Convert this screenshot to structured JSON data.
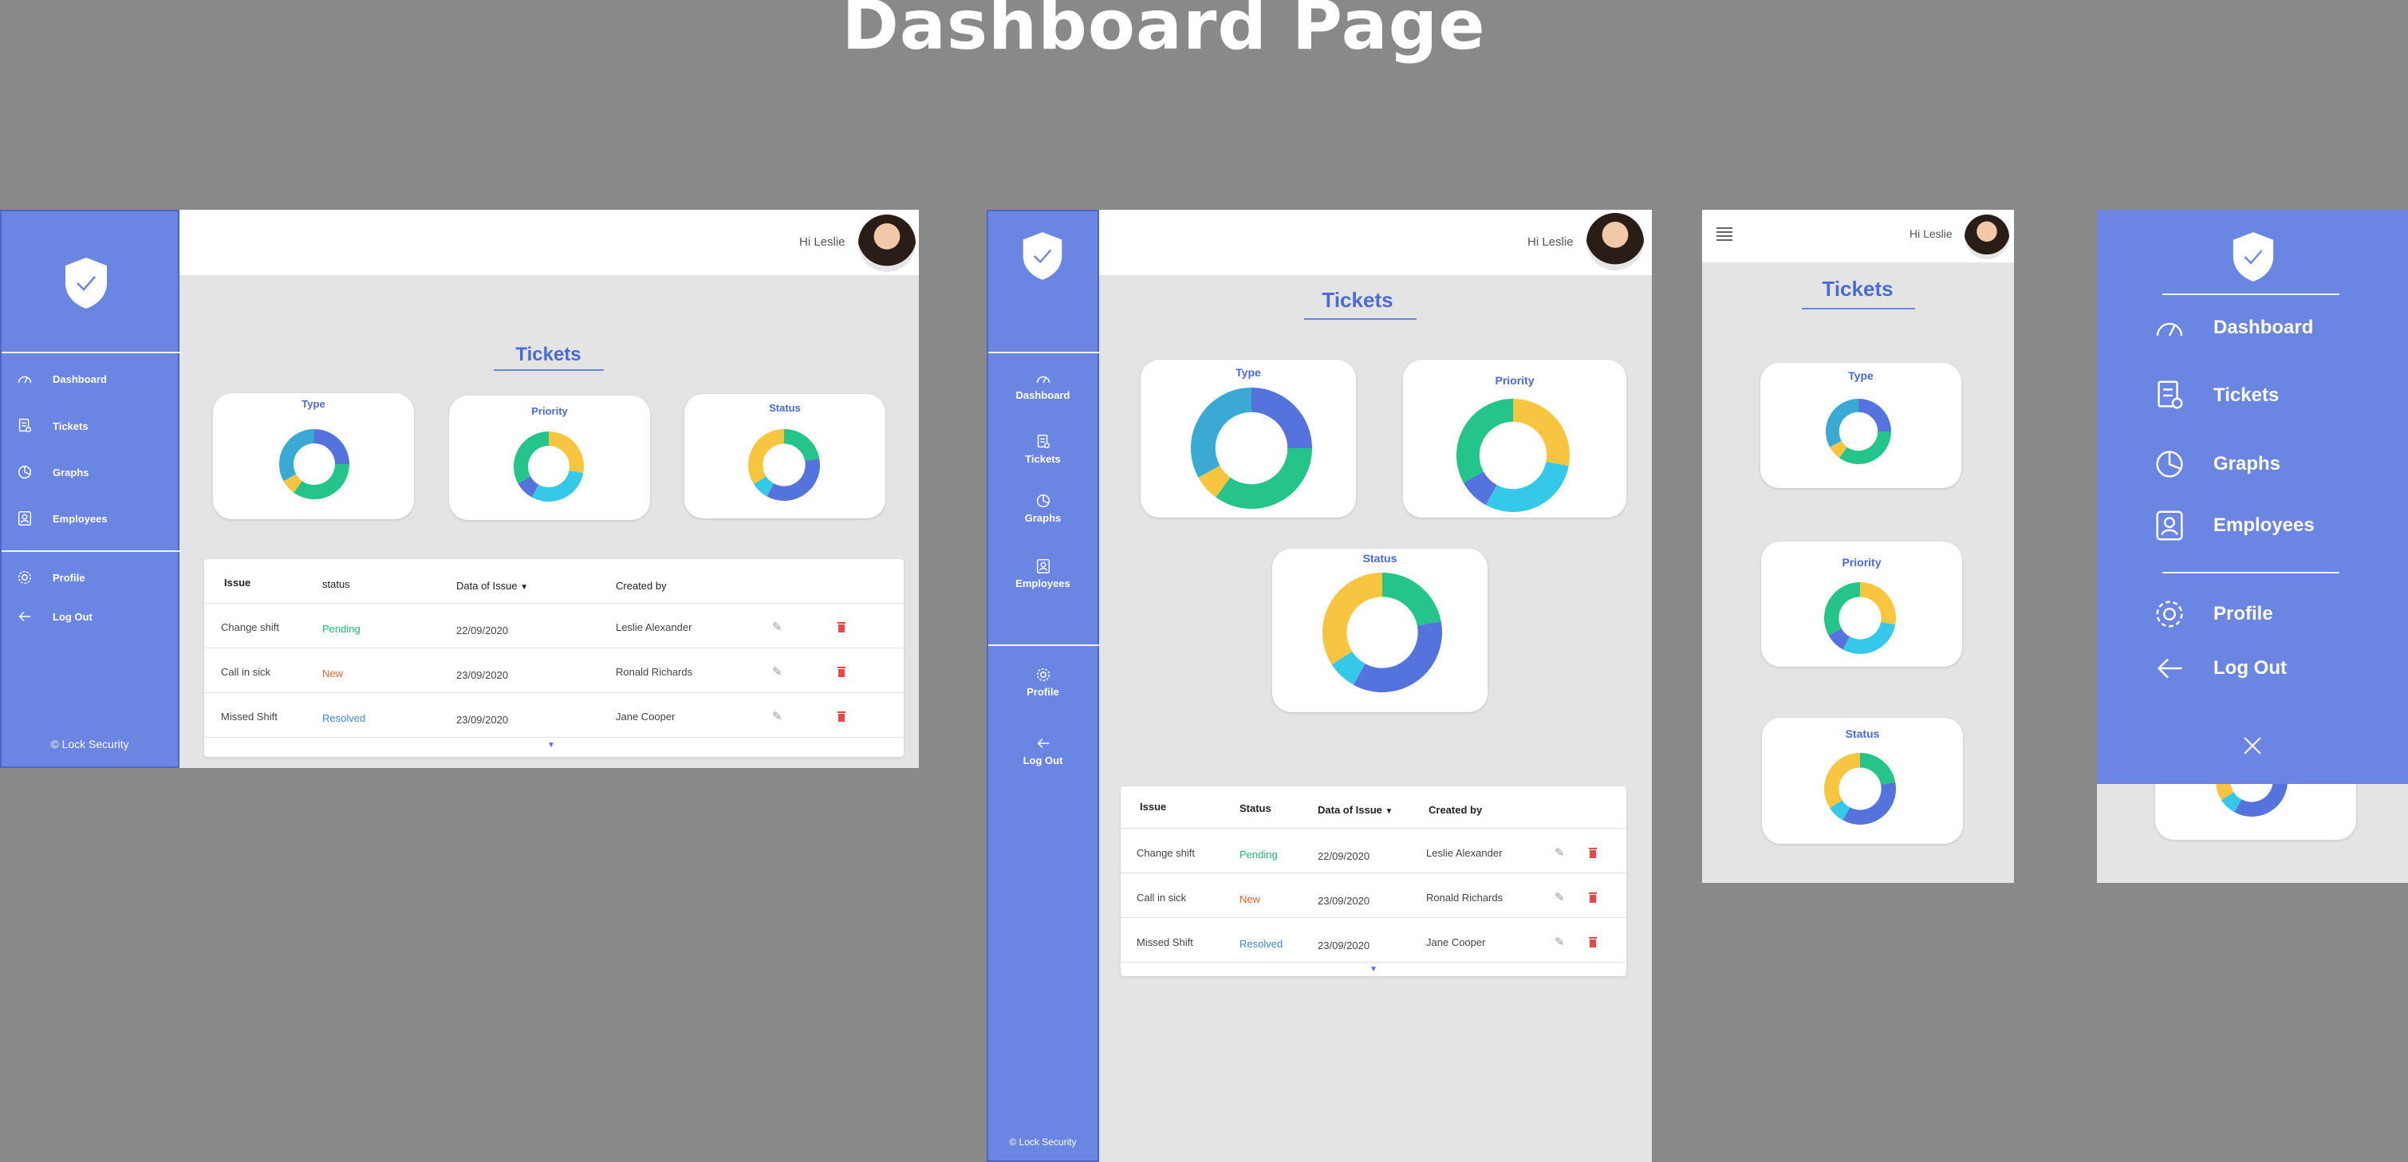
{
  "page_title": "Dashboard Page",
  "brand": "© Lock Security",
  "greeting": "Hi Leslie",
  "section_title": "Tickets",
  "nav": {
    "dashboard": "Dashboard",
    "tickets": "Tickets",
    "graphs": "Graphs",
    "employees": "Employees",
    "profile": "Profile",
    "logout": "Log Out"
  },
  "charts": {
    "type": "Type",
    "priority": "Priority",
    "status": "Status"
  },
  "table": {
    "headers_desktop": [
      "Issue",
      "status",
      "Data of Issue",
      "Created by"
    ],
    "headers_tablet": [
      "Issue",
      "Status",
      "Data of Issue",
      "Created by"
    ],
    "rows": [
      {
        "issue": "Change shift",
        "status": "Pending",
        "date": "22/09/2020",
        "created_by": "Leslie Alexander"
      },
      {
        "issue": "Call in sick",
        "status": "New",
        "date": "23/09/2020",
        "created_by": "Ronald Richards"
      },
      {
        "issue": "Missed Shift",
        "status": "Resolved",
        "date": "23/09/2020",
        "created_by": "Jane Cooper"
      }
    ]
  },
  "colors": {
    "primary": "#6b85e2",
    "accent_text": "#4a6ad8",
    "pending": "#22b573",
    "new": "#e8632a",
    "resolved": "#3b8ad9",
    "delete": "#e54848",
    "chart_blue": "#5473dc",
    "chart_green": "#25c48a",
    "chart_yellow": "#f7c540",
    "chart_cyan": "#36c8e8",
    "chart_teal": "#3aa9d4"
  }
}
